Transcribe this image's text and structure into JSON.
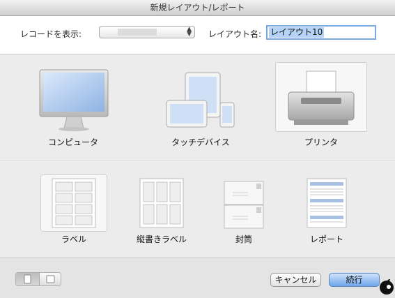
{
  "window": {
    "title": "新規レイアウト/レポート"
  },
  "header": {
    "records_label": "レコードを表示:",
    "layout_name_label": "レイアウト名:",
    "layout_name_value": "レイアウト10"
  },
  "devices": [
    {
      "label": "コンピュータ",
      "icon": "computer-monitor-icon",
      "selected": false
    },
    {
      "label": "タッチデバイス",
      "icon": "touch-devices-icon",
      "selected": false
    },
    {
      "label": "プリンタ",
      "icon": "printer-icon",
      "selected": true
    }
  ],
  "print_types": [
    {
      "label": "ラベル",
      "icon": "labels-icon",
      "selected": true
    },
    {
      "label": "縦書きラベル",
      "icon": "vertical-labels-icon",
      "selected": false
    },
    {
      "label": "封筒",
      "icon": "envelope-icon",
      "selected": false
    },
    {
      "label": "レポート",
      "icon": "report-icon",
      "selected": false
    }
  ],
  "footer": {
    "view_toggle_icons": [
      "large-icons-view-icon",
      "small-icons-view-icon"
    ],
    "cancel_label": "キャンセル",
    "continue_label": "続行"
  },
  "colors": {
    "accent": "#6fa6ea",
    "selection": "#b4d3f7",
    "focus_ring": "#7aa7e0"
  }
}
